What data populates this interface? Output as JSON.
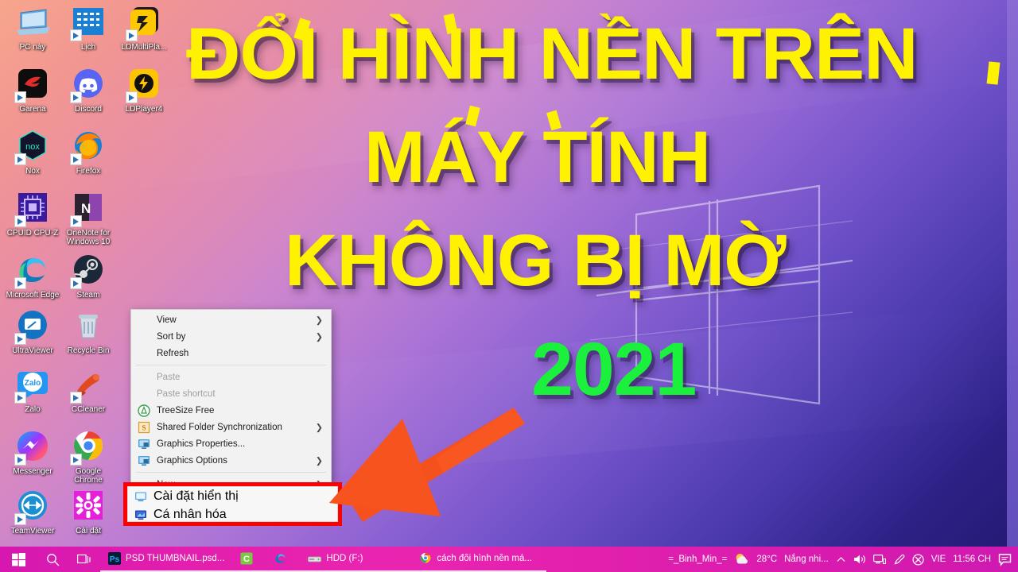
{
  "overlay": {
    "title_line1": "ĐỔI HÌNH NỀN TRÊN",
    "title_line2": "MÁY TÍNH",
    "title_line3": "KHÔNG BỊ MỜ",
    "year": "2021",
    "title_color": "#fff200",
    "year_color": "#1bf03c",
    "arrow_color": "#f4511e",
    "highlight_color": "#ff0000"
  },
  "desktop": {
    "icons": [
      {
        "label": "PC này",
        "icon": "this-pc-icon",
        "shortcut": false
      },
      {
        "label": "Lịch",
        "icon": "calendar-icon",
        "shortcut": true
      },
      {
        "label": "LDMultiPla...",
        "icon": "ldmultiplayer-icon",
        "shortcut": true
      },
      {
        "label": "Garena",
        "icon": "garena-icon",
        "shortcut": true
      },
      {
        "label": "Discord",
        "icon": "discord-icon",
        "shortcut": true
      },
      {
        "label": "LDPlayer4",
        "icon": "ldplayer-icon",
        "shortcut": true
      },
      {
        "label": "Nox",
        "icon": "nox-icon",
        "shortcut": true
      },
      {
        "label": "Firefox",
        "icon": "firefox-icon",
        "shortcut": true
      },
      {
        "label": "CPUID CPU-Z",
        "icon": "cpuz-icon",
        "shortcut": true
      },
      {
        "label": "OneNote for Windows 10",
        "icon": "onenote-icon",
        "shortcut": true
      },
      {
        "label": "Microsoft Edge",
        "icon": "edge-icon",
        "shortcut": true
      },
      {
        "label": "Steam",
        "icon": "steam-icon",
        "shortcut": true
      },
      {
        "label": "UltraViewer",
        "icon": "ultraviewer-icon",
        "shortcut": true
      },
      {
        "label": "Recycle Bin",
        "icon": "recycle-bin-icon",
        "shortcut": false
      },
      {
        "label": "Zalo",
        "icon": "zalo-icon",
        "shortcut": true
      },
      {
        "label": "CCleaner",
        "icon": "ccleaner-icon",
        "shortcut": true
      },
      {
        "label": "Messenger",
        "icon": "messenger-icon",
        "shortcut": true
      },
      {
        "label": "Google Chrome",
        "icon": "chrome-icon",
        "shortcut": true
      },
      {
        "label": "TeamViewer",
        "icon": "teamviewer-icon",
        "shortcut": true
      },
      {
        "label": "Cài đặt",
        "icon": "settings-icon",
        "shortcut": false
      }
    ]
  },
  "context_menu": {
    "items": [
      {
        "label": "View",
        "icon": null,
        "submenu": true,
        "disabled": false
      },
      {
        "label": "Sort by",
        "icon": null,
        "submenu": true,
        "disabled": false
      },
      {
        "label": "Refresh",
        "icon": null,
        "submenu": false,
        "disabled": false
      },
      {
        "separator": true
      },
      {
        "label": "Paste",
        "icon": null,
        "submenu": false,
        "disabled": true
      },
      {
        "label": "Paste shortcut",
        "icon": null,
        "submenu": false,
        "disabled": true
      },
      {
        "label": "TreeSize Free",
        "icon": "treesize-icon",
        "submenu": false,
        "disabled": false
      },
      {
        "label": "Shared Folder Synchronization",
        "icon": "shared-folder-sync-icon",
        "submenu": true,
        "disabled": false
      },
      {
        "label": "Graphics Properties...",
        "icon": "graphics-icon",
        "submenu": false,
        "disabled": false
      },
      {
        "label": "Graphics Options",
        "icon": "graphics-icon",
        "submenu": true,
        "disabled": false
      },
      {
        "separator": true
      },
      {
        "label": "New",
        "icon": null,
        "submenu": true,
        "disabled": false
      }
    ],
    "highlighted": [
      {
        "label": "Cài đặt hiển thị",
        "icon": "display-settings-icon"
      },
      {
        "label": "Cá nhân hóa",
        "icon": "personalize-icon"
      }
    ]
  },
  "taskbar": {
    "start": "start-icon",
    "search": "search-icon",
    "task_view": "task-view-icon",
    "tasks": [
      {
        "label": "PSD THUMBNAIL.psd...",
        "icon": "photoshop-icon"
      },
      {
        "label": "",
        "icon": "camtasia-icon"
      },
      {
        "label": "",
        "icon": "edge-icon"
      },
      {
        "label": "HDD (F:)",
        "icon": "file-explorer-icon"
      },
      {
        "label": "cách đổi hình nền má...",
        "icon": "chrome-icon"
      }
    ],
    "tray": {
      "user": "=_Binh_Min_=",
      "weather_icon": "weather-sun-cloud-icon",
      "temperature": "28°C",
      "weather_text": "Nắng nhi...",
      "chevron": "chevron-up-icon",
      "volume": "volume-icon",
      "network": "network-icon",
      "pen": "pen-icon",
      "antivirus": "antivirus-icon",
      "language": "VIE",
      "time": "11:56 CH",
      "notifications": "action-center-icon"
    }
  }
}
